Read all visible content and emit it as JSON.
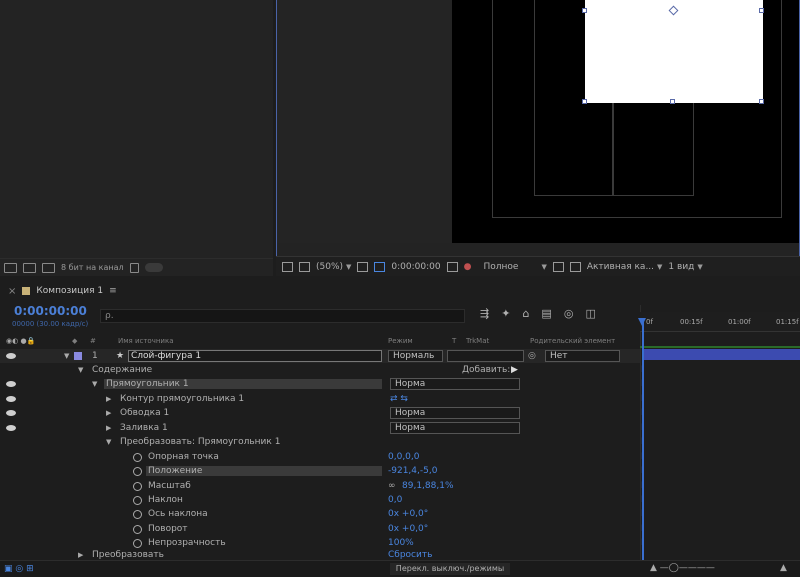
{
  "project": {
    "bit_depth": "8 бит на канал"
  },
  "viewer": {
    "zoom": "(50%)",
    "timecode": "0:00:00:00",
    "resolution": "Полное",
    "camera": "Активная ка...",
    "views": "1 вид"
  },
  "timeline": {
    "tab_title": "Композиция 1",
    "timecode": "0:00:00:00",
    "fps": "00000 (30.00 кадр/с)",
    "search_placeholder": "ρ.",
    "columns": {
      "source_name": "Имя источника",
      "mode": "Режим",
      "t": "T",
      "trkmat": "TrkMat",
      "parent": "Родительский элемент"
    },
    "ruler": [
      "0f",
      "00:15f",
      "01:00f",
      "01:15f"
    ],
    "layer": {
      "number": "1",
      "name": "Слой-фигура 1",
      "mode": "Нормаль",
      "parent": "Нет"
    },
    "rows": {
      "contents": "Содержание",
      "add": "Добавить:",
      "rect": "Прямоугольник 1",
      "rect_mode": "Норма",
      "path": "Контур прямоугольника 1",
      "stroke": "Обводка 1",
      "stroke_mode": "Норма",
      "fill": "Заливка 1",
      "fill_mode": "Норма",
      "transform_rect": "Преобразовать: Прямоугольник 1",
      "anchor": "Опорная точка",
      "anchor_val": "0,0,0,0",
      "position": "Положение",
      "position_val": "-921,4,-5,0",
      "scale": "Масштаб",
      "scale_val": "89,1,88,1%",
      "skew": "Наклон",
      "skew_val": "0,0",
      "skew_axis": "Ось наклона",
      "skew_axis_val": "0x +0,0°",
      "rotation": "Поворот",
      "rotation_val": "0x +0,0°",
      "opacity": "Непрозрачность",
      "opacity_val": "100%",
      "transform": "Преобразовать",
      "reset": "Сбросить"
    },
    "switch_modes": "Перекл. выключ./режимы"
  }
}
